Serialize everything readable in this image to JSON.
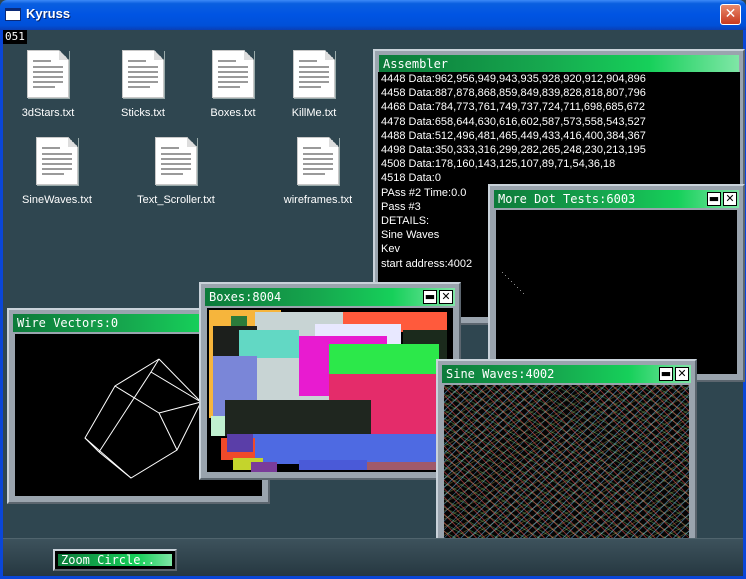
{
  "window": {
    "title": "Kyruss",
    "close_glyph": "✕"
  },
  "counter": "051",
  "files": [
    {
      "name": "3dStars.txt"
    },
    {
      "name": "Sticks.txt"
    },
    {
      "name": "Boxes.txt"
    },
    {
      "name": "KillMe.txt"
    },
    {
      "name": "SineWaves.txt"
    },
    {
      "name": "Text_Scroller.txt"
    },
    {
      "name": "wireframes.txt"
    }
  ],
  "windows": {
    "assembler": {
      "title": "Assembler",
      "lines": [
        "4448 Data:962,956,949,943,935,928,920,912,904,896",
        "4458 Data:887,878,868,859,849,839,828,818,807,796",
        "4468 Data:784,773,761,749,737,724,711,698,685,672",
        "4478 Data:658,644,630,616,602,587,573,558,543,527",
        "4488 Data:512,496,481,465,449,433,416,400,384,367",
        "4498 Data:350,333,316,299,282,265,248,230,213,195",
        "4508 Data:178,160,143,125,107,89,71,54,36,18",
        "4518 Data:0",
        "PAss #2 Time:0.0",
        "Pass #3",
        "DETAILS:",
        "Sine Waves",
        "Kev",
        "start address:4002"
      ]
    },
    "dot_tests": {
      "title": "More Dot Tests:6003"
    },
    "wire_vectors": {
      "title": "Wire Vectors:0"
    },
    "boxes": {
      "title": "Boxes:8004"
    },
    "sine_waves": {
      "title": "Sine Waves:4002"
    },
    "min_glyph": "▬",
    "close_glyph": "✕"
  },
  "taskbar": {
    "button_label": "Zoom Circle.."
  },
  "colors": {
    "desktop": "#2f4650",
    "titlebar_green": "#16a74e",
    "xp_blue": "#0054e3"
  }
}
